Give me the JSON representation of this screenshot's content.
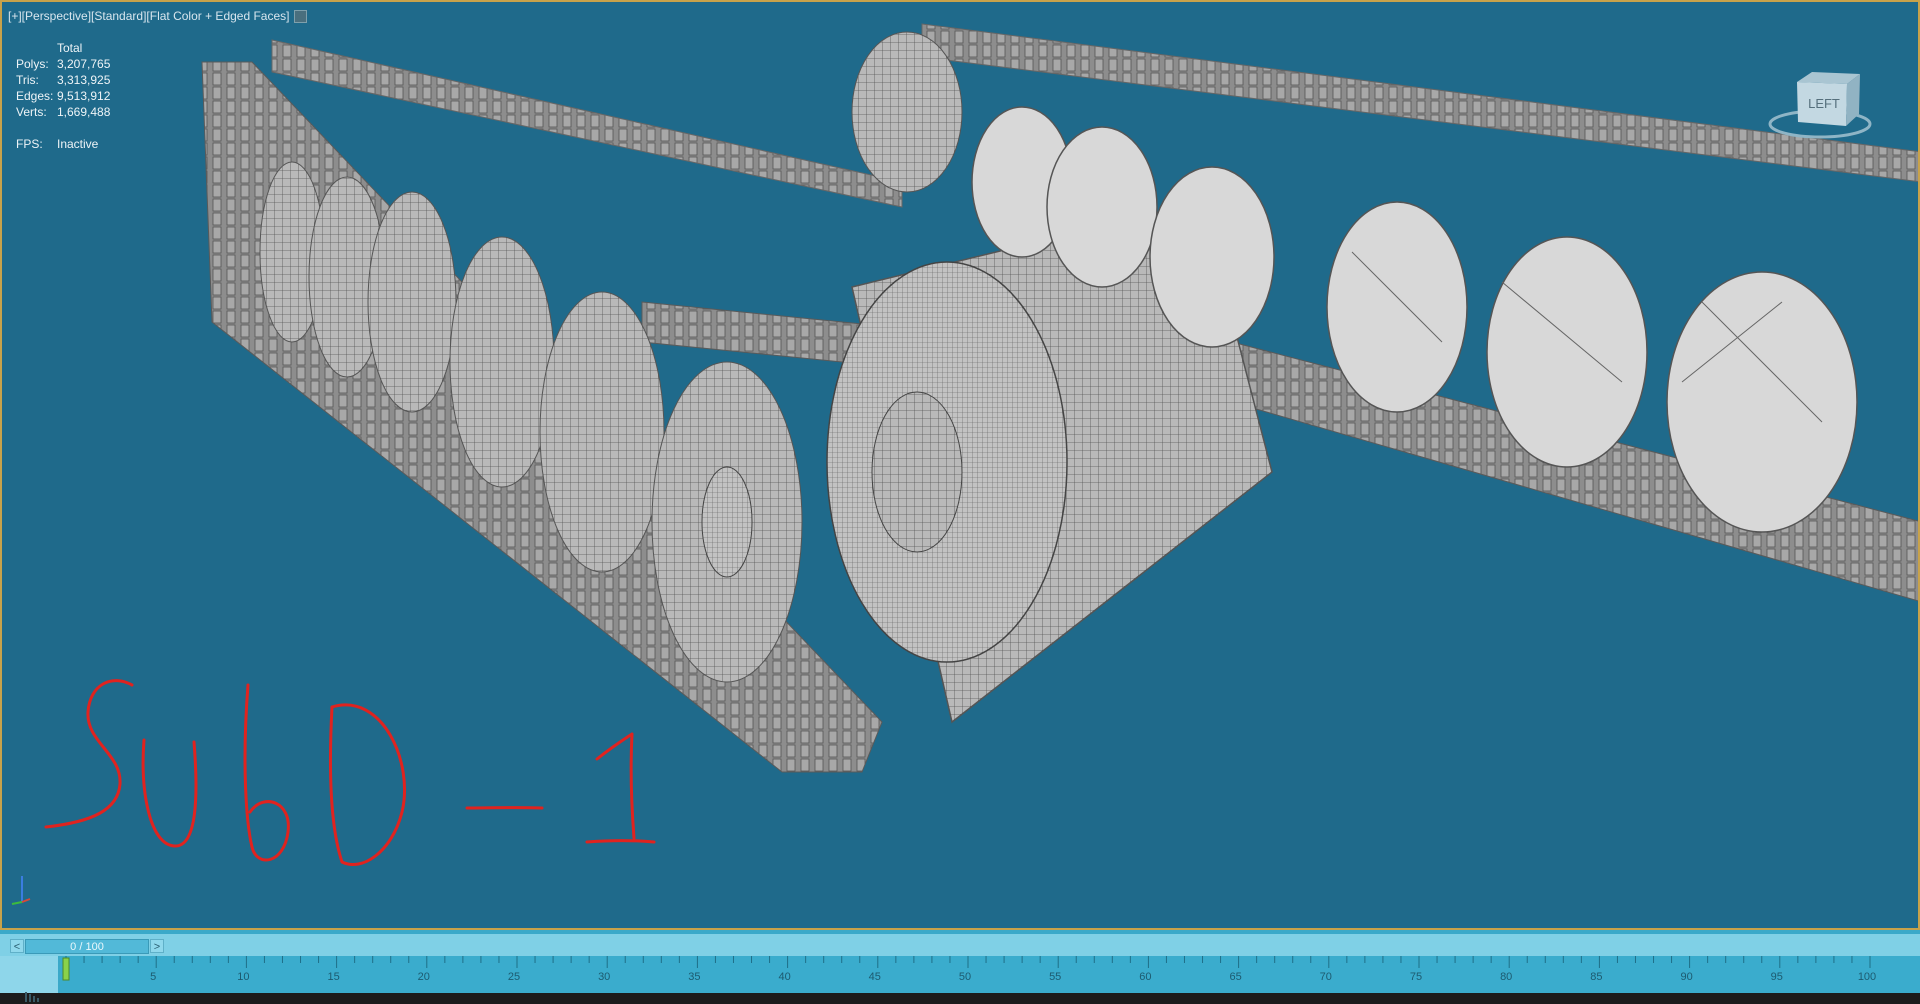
{
  "viewport": {
    "label": "[+][Perspective][Standard][Flat Color + Edged Faces]",
    "background": "#1f6a8b",
    "border_color": "#c8a24a"
  },
  "stats": {
    "header": "Total",
    "rows": [
      {
        "key": "Polys:",
        "value": "3,207,765"
      },
      {
        "key": "Tris:",
        "value": "3,313,925"
      },
      {
        "key": "Edges:",
        "value": "9,513,912"
      },
      {
        "key": "Verts:",
        "value": "1,669,488"
      }
    ],
    "fps_key": "FPS:",
    "fps_value": "Inactive"
  },
  "navcube": {
    "face_label": "LEFT",
    "icon": "viewcube-icon"
  },
  "gizmo": {
    "icon": "axis-gizmo-icon"
  },
  "annotation": {
    "text": "SubD - 1",
    "color": "#e0231f"
  },
  "timeline": {
    "prev_label": "<",
    "next_label": ">",
    "slider_text": "0 / 100",
    "current_frame": 0,
    "total_frames": 100,
    "tick_labels": [
      "5",
      "10",
      "15",
      "20",
      "25",
      "30",
      "35",
      "40",
      "45",
      "50",
      "55",
      "60",
      "65",
      "70",
      "75",
      "80",
      "85",
      "90",
      "95",
      "100"
    ],
    "track_icon": "track-bar-icon"
  }
}
